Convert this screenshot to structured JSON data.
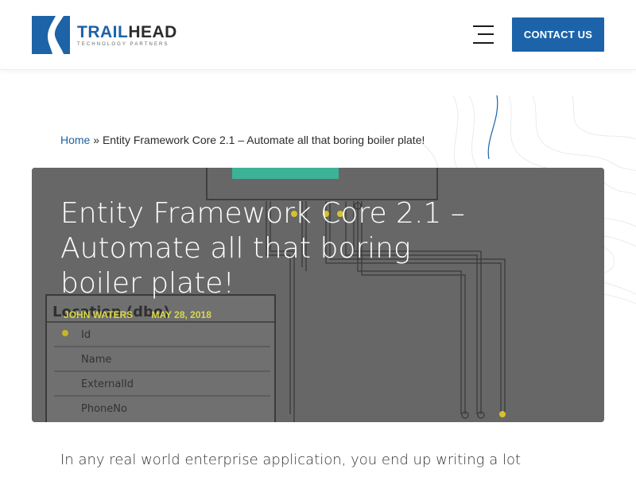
{
  "header": {
    "logo": {
      "name_part1": "TRAIL",
      "name_part2": "HEAD",
      "tagline": "TECHNOLOGY PARTNERS"
    },
    "menu_icon": "hamburger-icon",
    "contact_label": "CONTACT US"
  },
  "breadcrumb": {
    "home": "Home",
    "separator": "»",
    "current": "Entity Framework Core 2.1 – Automate all that boring boiler plate!"
  },
  "hero": {
    "title": "Entity Framework Core 2.1 – Automate all that boring boiler plate!",
    "author": "JOHN WATERS",
    "date": "MAY 28, 2018",
    "diagram": {
      "table_name": "Location (dbo)",
      "columns": [
        "Id",
        "Name",
        "ExternalId",
        "PhoneNo"
      ]
    }
  },
  "body": {
    "intro": "In any real world enterprise application, you end up writing a lot"
  },
  "colors": {
    "brand_blue": "#1c63a9",
    "meta_yellow": "#d9d84a",
    "teal": "#3cb397"
  }
}
